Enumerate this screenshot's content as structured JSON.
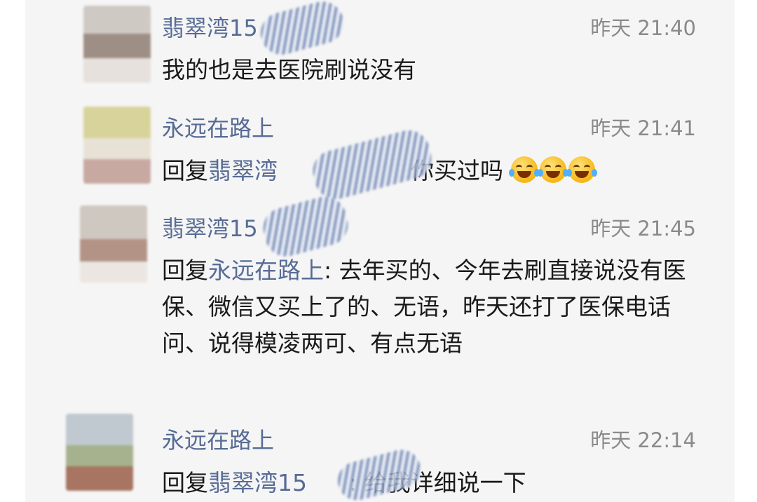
{
  "comments": [
    {
      "name": "翡翠湾15",
      "time": "昨天 21:40",
      "text": "我的也是去医院刷说没有"
    },
    {
      "name": "永远在路上",
      "time": "昨天 21:41",
      "reply_prefix": "回复",
      "reply_to": "翡翠湾",
      "text": "你买过吗",
      "emoji_icon": "laughing-tears-emoji-icon"
    },
    {
      "name": "翡翠湾15",
      "time": "昨天 21:45",
      "reply_prefix": "回复",
      "reply_to": "永远在路上",
      "text": ": 去年买的、今年去刷直接说没有医保、微信又买上了的、无语，昨天还打了医保电话问、说得模凌两可、有点无语"
    },
    {
      "name": "永远在路上",
      "time": "昨天 22:14",
      "reply_prefix": "回复",
      "reply_to": "翡翠湾15",
      "text": ": 给我详细说一下"
    }
  ],
  "colors": {
    "name": "#576b95",
    "time": "#8a8a8a",
    "text": "#1a1a1a",
    "background": "#f5f5f5"
  }
}
